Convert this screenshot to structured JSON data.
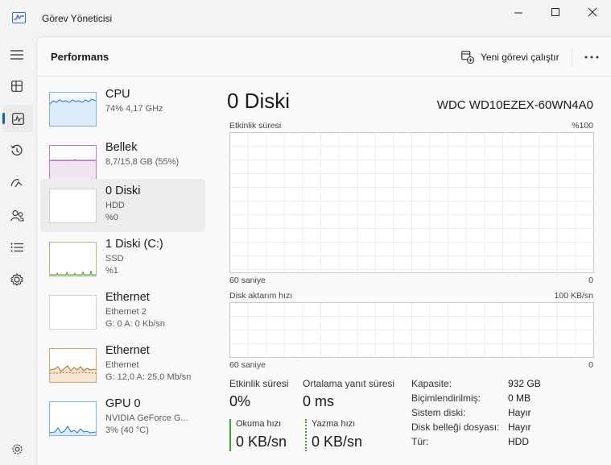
{
  "window": {
    "title": "Görev Yöneticisi"
  },
  "header": {
    "title": "Performans",
    "run_task_label": "Yeni görevi çalıştır"
  },
  "nav": [
    {
      "name": "menu-icon"
    },
    {
      "name": "processes-icon"
    },
    {
      "name": "performance-icon",
      "active": true
    },
    {
      "name": "app-history-icon"
    },
    {
      "name": "startup-apps-icon"
    },
    {
      "name": "users-icon"
    },
    {
      "name": "details-icon"
    },
    {
      "name": "services-icon"
    },
    {
      "name": "settings-icon"
    }
  ],
  "devices": [
    {
      "name": "CPU",
      "line2": "74% 4,17 GHz",
      "line3": "",
      "color": "#1f77d0"
    },
    {
      "name": "Bellek",
      "line2": "8,7/15,8 GB (55%)",
      "line3": "",
      "color": "#8b2a9e"
    },
    {
      "name": "0 Diski",
      "line2": "HDD",
      "line3": "%0",
      "color": "#4c9a2a",
      "selected": true
    },
    {
      "name": "1 Diski (C:)",
      "line2": "SSD",
      "line3": "%1",
      "color": "#4c9a2a"
    },
    {
      "name": "Ethernet",
      "line2": "Ethernet 2",
      "line3": "G: 0 A: 0 Kb/sn",
      "color": "#b5651d"
    },
    {
      "name": "Ethernet",
      "line2": "Ethernet",
      "line3": "G: 12,0 A: 25,0 Mb/sn",
      "color": "#b5651d"
    },
    {
      "name": "GPU 0",
      "line2": "NVIDIA GeForce G...",
      "line3": "3% (40 °C)",
      "color": "#1f77d0"
    }
  ],
  "detail": {
    "title": "0 Diski",
    "model": "WDC WD10EZEX-60WN4A0",
    "graph1": {
      "label": "Etkinlik süresi",
      "max": "%100",
      "time": "60 saniye",
      "min": "0"
    },
    "graph2": {
      "label": "Disk aktarım hızı",
      "max": "100 KB/sn",
      "time": "60 saniye",
      "min": "0"
    },
    "stats": {
      "active_time_label": "Etkinlik süresi",
      "active_time_value": "0%",
      "response_label": "Ortalama yanıt süresi",
      "response_value": "0 ms",
      "read_label": "Okuma hızı",
      "read_value": "0 KB/sn",
      "write_label": "Yazma hızı",
      "write_value": "0 KB/sn"
    },
    "properties": [
      {
        "label": "Kapasite:",
        "value": "932 GB"
      },
      {
        "label": "Biçimlendirilmiş:",
        "value": "0 MB"
      },
      {
        "label": "Sistem diski:",
        "value": "Hayır"
      },
      {
        "label": "Disk belleği dosyası:",
        "value": "Hayır"
      },
      {
        "label": "Tür:",
        "value": "HDD"
      }
    ]
  }
}
